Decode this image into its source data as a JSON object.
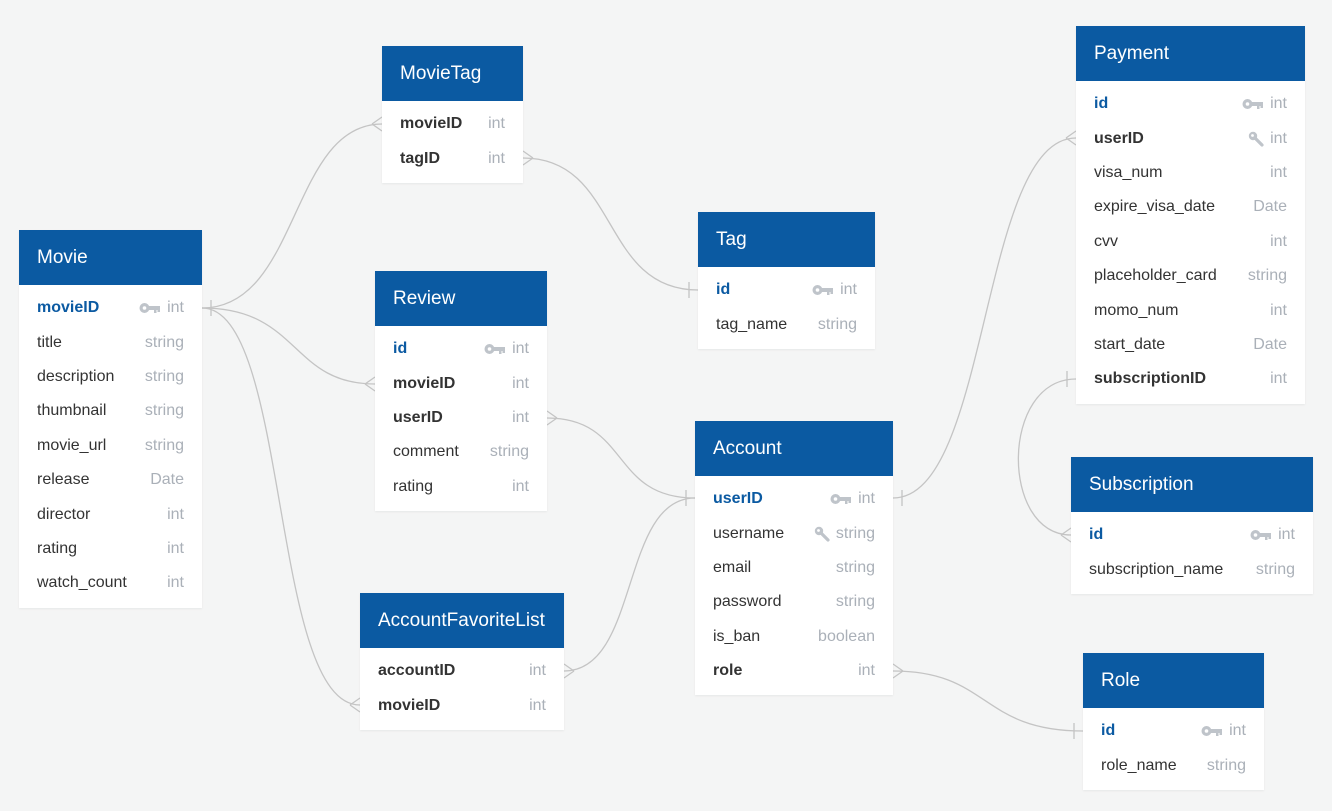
{
  "colors": {
    "header": "#0b5aa2",
    "background": "#f4f5f5",
    "edge": "#c4c4c4",
    "type_text": "#aab0b8"
  },
  "tables": [
    {
      "name": "MovieTag",
      "columns": [
        {
          "name": "movieID",
          "type": "int",
          "style": "ref"
        },
        {
          "name": "tagID",
          "type": "int",
          "style": "ref"
        }
      ]
    },
    {
      "name": "Movie",
      "columns": [
        {
          "name": "movieID",
          "type": "int",
          "style": "pk",
          "icon": "primary-key-icon"
        },
        {
          "name": "title",
          "type": "string"
        },
        {
          "name": "description",
          "type": "string"
        },
        {
          "name": "thumbnail",
          "type": "string"
        },
        {
          "name": "movie_url",
          "type": "string"
        },
        {
          "name": "release",
          "type": "Date"
        },
        {
          "name": "director",
          "type": "int"
        },
        {
          "name": "rating",
          "type": "int"
        },
        {
          "name": "watch_count",
          "type": "int"
        }
      ]
    },
    {
      "name": "Review",
      "columns": [
        {
          "name": "id",
          "type": "int",
          "style": "pk",
          "icon": "primary-key-icon"
        },
        {
          "name": "movieID",
          "type": "int",
          "style": "ref"
        },
        {
          "name": "userID",
          "type": "int",
          "style": "ref"
        },
        {
          "name": "comment",
          "type": "string"
        },
        {
          "name": "rating",
          "type": "int"
        }
      ]
    },
    {
      "name": "Tag",
      "columns": [
        {
          "name": "id",
          "type": "int",
          "style": "pk",
          "icon": "primary-key-icon"
        },
        {
          "name": "tag_name",
          "type": "string"
        }
      ]
    },
    {
      "name": "Account",
      "columns": [
        {
          "name": "userID",
          "type": "int",
          "style": "pk",
          "icon": "primary-key-icon"
        },
        {
          "name": "username",
          "type": "string",
          "icon": "unique-key-icon"
        },
        {
          "name": "email",
          "type": "string"
        },
        {
          "name": "password",
          "type": "string"
        },
        {
          "name": "is_ban",
          "type": "boolean"
        },
        {
          "name": "role",
          "type": "int",
          "style": "ref"
        }
      ]
    },
    {
      "name": "AccountFavoriteList",
      "columns": [
        {
          "name": "accountID",
          "type": "int",
          "style": "ref"
        },
        {
          "name": "movieID",
          "type": "int",
          "style": "ref"
        }
      ]
    },
    {
      "name": "Payment",
      "columns": [
        {
          "name": "id",
          "type": "int",
          "style": "pk",
          "icon": "primary-key-icon"
        },
        {
          "name": "userID",
          "type": "int",
          "style": "ref",
          "icon": "unique-key-icon"
        },
        {
          "name": "visa_num",
          "type": "int"
        },
        {
          "name": "expire_visa_date",
          "type": "Date"
        },
        {
          "name": "cvv",
          "type": "int"
        },
        {
          "name": "placeholder_card",
          "type": "string"
        },
        {
          "name": "momo_num",
          "type": "int"
        },
        {
          "name": "start_date",
          "type": "Date"
        },
        {
          "name": "subscriptionID",
          "type": "int",
          "style": "ref"
        }
      ]
    },
    {
      "name": "Subscription",
      "columns": [
        {
          "name": "id",
          "type": "int",
          "style": "pk",
          "icon": "primary-key-icon"
        },
        {
          "name": "subscription_name",
          "type": "string"
        }
      ]
    },
    {
      "name": "Role",
      "columns": [
        {
          "name": "id",
          "type": "int",
          "style": "pk",
          "icon": "primary-key-icon"
        },
        {
          "name": "role_name",
          "type": "string"
        }
      ]
    }
  ],
  "relations": [
    {
      "from": "Movie.movieID",
      "to": "MovieTag.movieID",
      "type": "one-to-many"
    },
    {
      "from": "Movie.movieID",
      "to": "Review.movieID",
      "type": "one-to-many"
    },
    {
      "from": "Movie.movieID",
      "to": "AccountFavoriteList.movieID",
      "type": "one-to-many"
    },
    {
      "from": "Tag.id",
      "to": "MovieTag.tagID",
      "type": "one-to-many"
    },
    {
      "from": "Account.userID",
      "to": "Review.userID",
      "type": "one-to-many"
    },
    {
      "from": "Account.userID",
      "to": "AccountFavoriteList.accountID",
      "type": "one-to-many"
    },
    {
      "from": "Account.userID",
      "to": "Payment.userID",
      "type": "one-to-many"
    },
    {
      "from": "Subscription.id",
      "to": "Payment.subscriptionID",
      "type": "one-to-many"
    },
    {
      "from": "Role.id",
      "to": "Account.role",
      "type": "one-to-many"
    }
  ]
}
